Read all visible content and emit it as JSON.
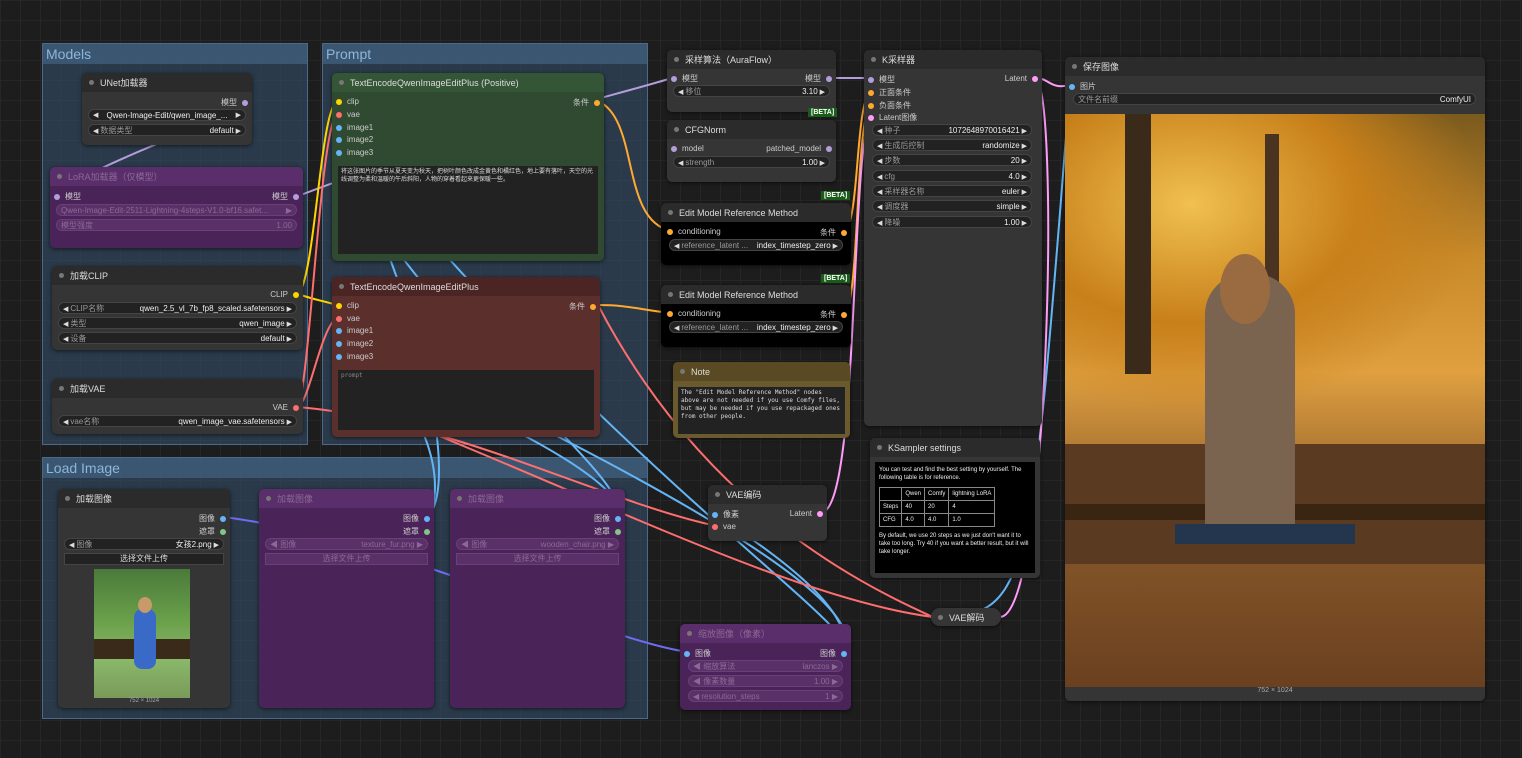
{
  "groups": {
    "models": "Models",
    "prompt": "Prompt",
    "load_image": "Load Image"
  },
  "unet": {
    "title": "UNet加载器",
    "out": "模型",
    "w1_label": "",
    "w1_value": "Qwen-Image-Edit/qwen_image_...",
    "w2_label": "数据类型",
    "w2_value": "default"
  },
  "lora": {
    "title": "LoRA加载器（仅模型）",
    "in": "模型",
    "out": "模型",
    "w1_value": "Qwen-Image-Edit-2511-Lightning-4steps-V1.0-bf16.safet...",
    "w2_label": "模型强度",
    "w2_value": "1.00"
  },
  "clip": {
    "title": "加载CLIP",
    "out": "CLIP",
    "w1_label": "CLIP名称",
    "w1_value": "qwen_2.5_vl_7b_fp8_scaled.safetensors",
    "w2_label": "类型",
    "w2_value": "qwen_image",
    "w3_label": "设备",
    "w3_value": "default"
  },
  "vae": {
    "title": "加载VAE",
    "out": "VAE",
    "w1_label": "vae名称",
    "w1_value": "qwen_image_vae.safetensors"
  },
  "pos": {
    "title": "TextEncodeQwenImageEditPlus (Positive)",
    "inputs": [
      "clip",
      "vae",
      "image1",
      "image2",
      "image3"
    ],
    "out": "条件",
    "text": "将这张图片的季节从夏天变为秋天，把树叶颜色改成金黄色和橘红色，地上要有落叶，天空的光线调整为柔和温暖的午后斜阳，人物的穿着看起来更保暖一些。"
  },
  "neg": {
    "title": "TextEncodeQwenImageEditPlus",
    "inputs": [
      "clip",
      "vae",
      "image1",
      "image2",
      "image3"
    ],
    "out": "条件",
    "text": "prompt"
  },
  "aura": {
    "title": "采样算法（AuraFlow）",
    "in": "模型",
    "out": "模型",
    "w1_label": "移位",
    "w1_value": "3.10"
  },
  "cfgnorm": {
    "title": "CFGNorm",
    "in": "model",
    "out": "patched_model",
    "w1_label": "strength",
    "w1_value": "1.00",
    "beta": "[BETA]"
  },
  "emr1": {
    "title": "Edit Model Reference Method",
    "in": "conditioning",
    "out": "条件",
    "w1_label": "reference_latent ...",
    "w1_value": "index_timestep_zero",
    "beta": "[BETA]"
  },
  "emr2": {
    "title": "Edit Model Reference Method",
    "in": "conditioning",
    "out": "条件",
    "w1_label": "reference_latent ...",
    "w1_value": "index_timestep_zero",
    "beta": "[BETA]"
  },
  "note": {
    "title": "Note",
    "text": "The \"Edit Model Reference Method\" nodes above are not needed if you use Comfy files, but may be needed if you use repackaged ones from other people."
  },
  "ksampler": {
    "title": "K采样器",
    "inputs": [
      "模型",
      "正面条件",
      "负面条件",
      "Latent图像"
    ],
    "out": "Latent",
    "widgets": [
      {
        "l": "种子",
        "v": "1072648970016421"
      },
      {
        "l": "生成后控制",
        "v": "randomize"
      },
      {
        "l": "步数",
        "v": "20"
      },
      {
        "l": "cfg",
        "v": "4.0"
      },
      {
        "l": "采样器名称",
        "v": "euler"
      },
      {
        "l": "调度器",
        "v": "simple"
      },
      {
        "l": "降噪",
        "v": "1.00"
      }
    ]
  },
  "kset": {
    "title": "KSampler settings",
    "intro": "You can test and find the best setting by yourself. The following table is for reference.",
    "header": [
      "",
      "Qwen",
      "Comfy",
      "lightning LoRA"
    ],
    "rows": [
      [
        "Steps",
        "40",
        "20",
        "4"
      ],
      [
        "CFG",
        "4.0",
        "4.0",
        "1.0"
      ]
    ],
    "outro": "By default, we use 20 steps as we just don't want it to take too long. Try 40 if you want a better result, but it will take longer."
  },
  "save": {
    "title": "保存图像",
    "in": "图片",
    "w1_label": "文件名前缀",
    "w1_value": "ComfyUI",
    "size": "752 × 1024"
  },
  "vaeenc": {
    "title": "VAE编码",
    "in1": "像素",
    "in2": "vae",
    "out": "Latent"
  },
  "vaedec": {
    "title": "VAE解码"
  },
  "load1": {
    "title": "加载图像",
    "out1": "图像",
    "out2": "遮罩",
    "w1_label": "图像",
    "w1_value": "女孩2.png",
    "btn": "选择文件上传",
    "size": "752 × 1024"
  },
  "load2": {
    "title": "加载图像",
    "out1": "图像",
    "out2": "遮罩",
    "w1_label": "图像",
    "w1_value": "texture_fur.png",
    "btn": "选择文件上传"
  },
  "load3": {
    "title": "加载图像",
    "out1": "图像",
    "out2": "遮罩",
    "w1_label": "图像",
    "w1_value": "wooden_chair.png",
    "btn": "选择文件上传"
  },
  "scale": {
    "title": "缩放图像（像素）",
    "in": "图像",
    "out": "图像",
    "w1_label": "缩放算法",
    "w1_value": "lanczos",
    "w2_label": "像素数量",
    "w2_value": "1.00",
    "w3_label": "resolution_steps",
    "w3_value": "1"
  },
  "colors": {
    "model": "#b39ddb",
    "clip": "#ffd500",
    "vae": "#ff6e6e",
    "cond": "#ffa931",
    "latent": "#ff9cf9",
    "image": "#64b5f6",
    "mask": "#81c784"
  }
}
